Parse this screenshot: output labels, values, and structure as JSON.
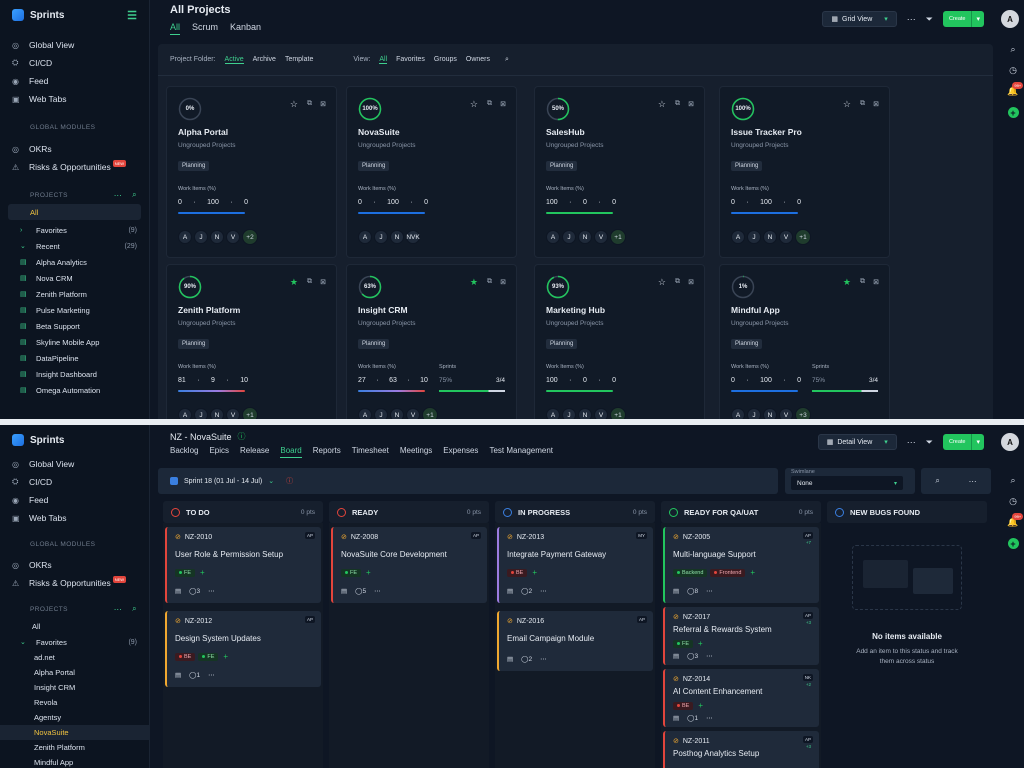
{
  "colors": {
    "accent": "#3ecf8e",
    "primary_button": "#22c55e",
    "alert": "#e2453c",
    "bg": "#0e1624"
  },
  "top": {
    "brand": "Sprints",
    "nav": [
      {
        "label": "Global View",
        "icon": "globe-icon"
      },
      {
        "label": "CI/CD",
        "icon": "pipeline-icon"
      },
      {
        "label": "Feed",
        "icon": "feed-icon"
      },
      {
        "label": "Web Tabs",
        "icon": "tabs-icon"
      }
    ],
    "global_modules_title": "GLOBAL MODULES",
    "modules": [
      {
        "label": "OKRs",
        "icon": "target-icon"
      },
      {
        "label": "Risks & Opportunities",
        "icon": "risk-icon",
        "badge": "NEW"
      }
    ],
    "projects_title": "PROJECTS",
    "projects_all": "All",
    "favorites": {
      "label": "Favorites",
      "count": "(9)"
    },
    "recent": {
      "label": "Recent",
      "count": "(29)"
    },
    "project_list": [
      "Alpha Analytics",
      "Nova CRM",
      "Zenith Platform",
      "Pulse Marketing",
      "Beta Support",
      "Skyline Mobile App",
      "DataPipeline",
      "Insight Dashboard",
      "Omega Automation"
    ],
    "title": "All Projects",
    "tabs": [
      "All",
      "Scrum",
      "Kanban"
    ],
    "view_button": "Grid View",
    "create": "Create",
    "avatar": "A",
    "notif_count": "99+",
    "filter": {
      "folder_label": "Project Folder:",
      "folders": [
        "Active",
        "Archive",
        "Template"
      ],
      "view_label": "View:",
      "views": [
        "All",
        "Favorites",
        "Groups",
        "Owners"
      ]
    },
    "cards": [
      {
        "pct": "0%",
        "name": "Alpha Portal",
        "group": "Ungrouped Projects",
        "tag": "Planning",
        "wi_label": "Work Items (%)",
        "wi": [
          "0",
          "100",
          "0"
        ],
        "bar": "#1d6fe0",
        "avatars": [
          "A",
          "J",
          "N",
          "V"
        ],
        "more": "+2",
        "fav": false
      },
      {
        "pct": "100%",
        "name": "NovaSuite",
        "group": "Ungrouped Projects",
        "tag": "Planning",
        "wi_label": "Work Items (%)",
        "wi": [
          "0",
          "100",
          "0"
        ],
        "bar": "#1d6fe0",
        "avatars": [
          "A",
          "J",
          "N",
          "NVK"
        ],
        "more": "",
        "fav": false
      },
      {
        "pct": "50%",
        "name": "SalesHub",
        "group": "Ungrouped Projects",
        "tag": "Planning",
        "wi_label": "Work Items (%)",
        "wi": [
          "100",
          "0",
          "0"
        ],
        "bar": "#22c55e",
        "avatars": [
          "A",
          "J",
          "N",
          "V"
        ],
        "more": "+1",
        "fav": false
      },
      {
        "pct": "100%",
        "name": "Issue Tracker Pro",
        "group": "Ungrouped Projects",
        "tag": "Planning",
        "wi_label": "Work Items (%)",
        "wi": [
          "0",
          "100",
          "0"
        ],
        "bar": "#1d6fe0",
        "avatars": [
          "A",
          "J",
          "N",
          "V"
        ],
        "more": "+1",
        "fav": false
      },
      {
        "pct": "90%",
        "name": "Zenith Platform",
        "group": "Ungrouped Projects",
        "tag": "Planning",
        "wi_label": "Work Items (%)",
        "wi": [
          "81",
          "9",
          "10"
        ],
        "bar": "gradient",
        "avatars": [
          "A",
          "J",
          "N",
          "V"
        ],
        "more": "+1",
        "fav": true
      },
      {
        "pct": "63%",
        "name": "Insight CRM",
        "group": "Ungrouped Projects",
        "tag": "Planning",
        "wi_label": "Work Items (%)",
        "wi": [
          "27",
          "63",
          "10"
        ],
        "bar": "gradient",
        "avatars": [
          "A",
          "J",
          "N",
          "V"
        ],
        "more": "+1",
        "fav": true,
        "sprint": {
          "label": "Sprints",
          "pct": "75%",
          "val": "3/4"
        }
      },
      {
        "pct": "93%",
        "name": "Marketing Hub",
        "group": "Ungrouped Projects",
        "tag": "Planning",
        "wi_label": "Work Items (%)",
        "wi": [
          "100",
          "0",
          "0"
        ],
        "bar": "#22c55e",
        "avatars": [
          "A",
          "J",
          "N",
          "V"
        ],
        "more": "+1",
        "fav": false
      },
      {
        "pct": "1%",
        "name": "Mindful App",
        "group": "Ungrouped Projects",
        "tag": "Planning",
        "wi_label": "Work Items (%)",
        "wi": [
          "0",
          "100",
          "0"
        ],
        "bar": "#1d6fe0",
        "avatars": [
          "A",
          "J",
          "N",
          "V"
        ],
        "more": "+3",
        "fav": true,
        "sprint": {
          "label": "Sprints",
          "pct": "75%",
          "val": "3/4"
        }
      }
    ]
  },
  "bottom": {
    "brand": "Sprints",
    "nav": [
      {
        "label": "Global View"
      },
      {
        "label": "CI/CD"
      },
      {
        "label": "Feed"
      },
      {
        "label": "Web Tabs"
      }
    ],
    "global_modules_title": "GLOBAL MODULES",
    "modules": [
      {
        "label": "OKRs"
      },
      {
        "label": "Risks & Opportunities",
        "badge": "NEW"
      }
    ],
    "projects_title": "PROJECTS",
    "projects_all": "All",
    "favorites": {
      "label": "Favorites",
      "count": "(9)"
    },
    "fav_list": [
      "ad.net",
      "Alpha Portal",
      "Insight CRM",
      "Revola",
      "Agentsy",
      "NovaSuite",
      "Zenith Platform",
      "Mindful App"
    ],
    "title": "NZ - NovaSuite",
    "tabs": [
      "Backlog",
      "Epics",
      "Release",
      "Board",
      "Reports",
      "Timesheet",
      "Meetings",
      "Expenses",
      "Test Management"
    ],
    "view_button": "Detail View",
    "create": "Create",
    "avatar": "A",
    "notif_count": "99+",
    "sprint": "Sprint 18 (01 Jul - 14 Jul)",
    "swimlane_label": "Swimlane",
    "swimlane_value": "None",
    "columns": [
      {
        "name": "TO DO",
        "pts": "0 pts",
        "color": "#e2453c"
      },
      {
        "name": "READY",
        "pts": "0 pts",
        "color": "#e2453c"
      },
      {
        "name": "IN PROGRESS",
        "pts": "0 pts",
        "color": "#3a7fe0"
      },
      {
        "name": "READY FOR QA/UAT",
        "pts": "0 pts",
        "color": "#22c55e"
      },
      {
        "name": "NEW BUGS FOUND",
        "pts": "",
        "color": "#3a7fe0"
      }
    ],
    "tickets": {
      "c0": [
        {
          "id": "NZ-2010",
          "title": "User Role & Permission Setup",
          "who": "AP",
          "labels": [
            "FE"
          ],
          "a": "3",
          "border": "#e2453c"
        },
        {
          "id": "NZ-2012",
          "title": "Design System Updates",
          "who": "AP",
          "labels": [
            "BE",
            "FE"
          ],
          "a": "1",
          "border": "#f0a830"
        }
      ],
      "c1": [
        {
          "id": "NZ-2008",
          "title": "NovaSuite Core Development",
          "who": "AP",
          "labels": [
            "FE"
          ],
          "a": "5",
          "border": "#e2453c"
        }
      ],
      "c2": [
        {
          "id": "NZ-2013",
          "title": "Integrate Payment Gateway",
          "who": "MY",
          "labels": [
            "BE"
          ],
          "a": "2",
          "border": "#9b7be0"
        },
        {
          "id": "NZ-2016",
          "title": "Email Campaign Module",
          "who": "AP",
          "labels": [],
          "a": "2",
          "border": "#f0a830"
        }
      ],
      "c3": [
        {
          "id": "NZ-2005",
          "title": "Multi-language Support",
          "who": "AP",
          "who2": "+7",
          "labels": [
            "Backend",
            "Frontend"
          ],
          "a": "8",
          "border": "#22c55e"
        },
        {
          "id": "NZ-2017",
          "title": "Referral & Rewards System",
          "who": "AP",
          "who2": "+3",
          "labels": [
            "FE"
          ],
          "a": "3",
          "border": "#e2453c"
        },
        {
          "id": "NZ-2014",
          "title": "AI Content Enhancement",
          "who": "NK",
          "who2": "+2",
          "labels": [
            "BE"
          ],
          "a": "1",
          "border": "#e2453c"
        },
        {
          "id": "NZ-2011",
          "title": "Posthog Analytics Setup",
          "who": "AP",
          "who2": "+3",
          "labels": [],
          "a": "",
          "border": "#e2453c"
        }
      ]
    },
    "empty_title": "No items available",
    "empty_desc": "Add an item to this status and track them across status"
  }
}
